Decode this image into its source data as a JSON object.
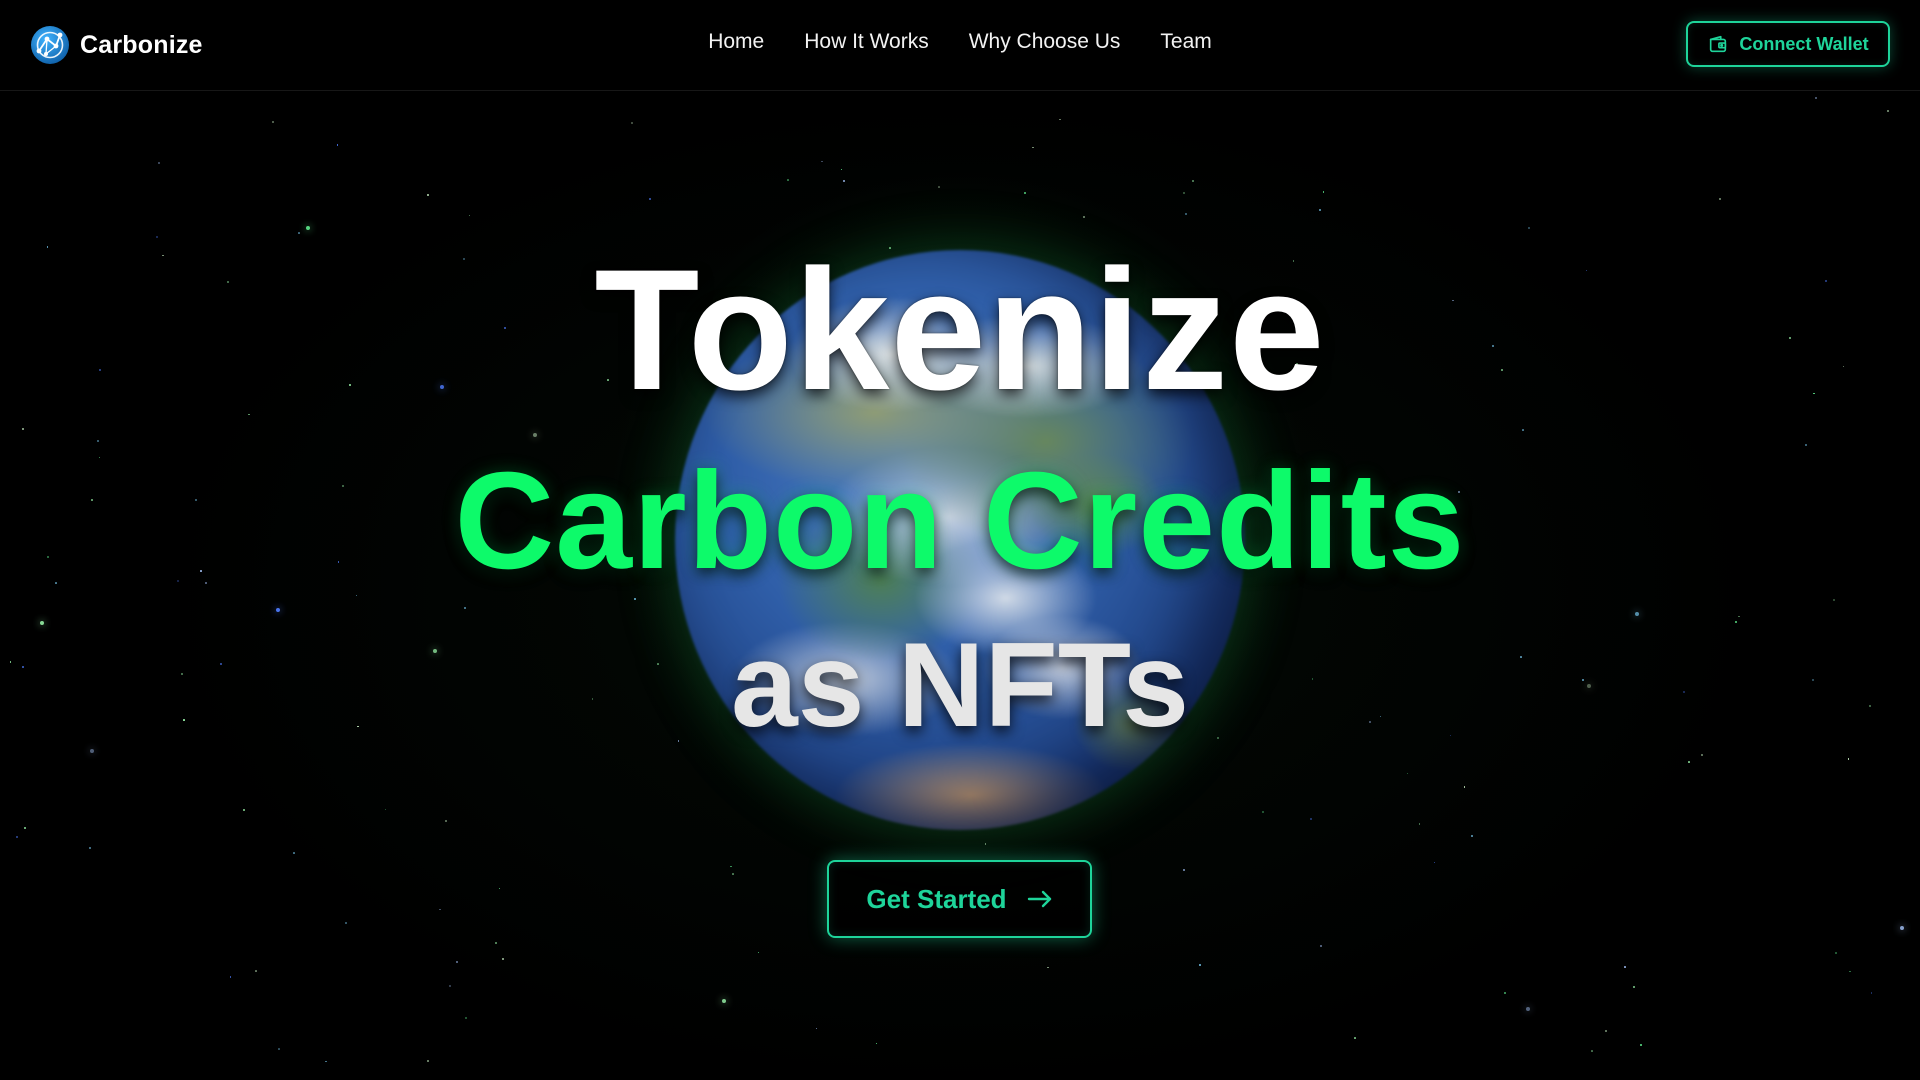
{
  "brand": {
    "name": "Carbonize",
    "logo_icon": "network-globe-icon"
  },
  "nav": {
    "items": [
      {
        "label": "Home"
      },
      {
        "label": "How It Works"
      },
      {
        "label": "Why Choose Us"
      },
      {
        "label": "Team"
      }
    ]
  },
  "header": {
    "connect_wallet_label": "Connect Wallet",
    "connect_wallet_icon": "wallet-icon"
  },
  "hero": {
    "line1": "Tokenize",
    "line2": "Carbon Credits",
    "line3": "as NFTs",
    "cta_label": "Get Started",
    "cta_icon": "arrow-right-icon",
    "background_image": "earth-globe"
  },
  "colors": {
    "accent": "#1ed49a",
    "headline_green": "#0dfa6a",
    "background": "#000000",
    "text": "#ffffff"
  }
}
